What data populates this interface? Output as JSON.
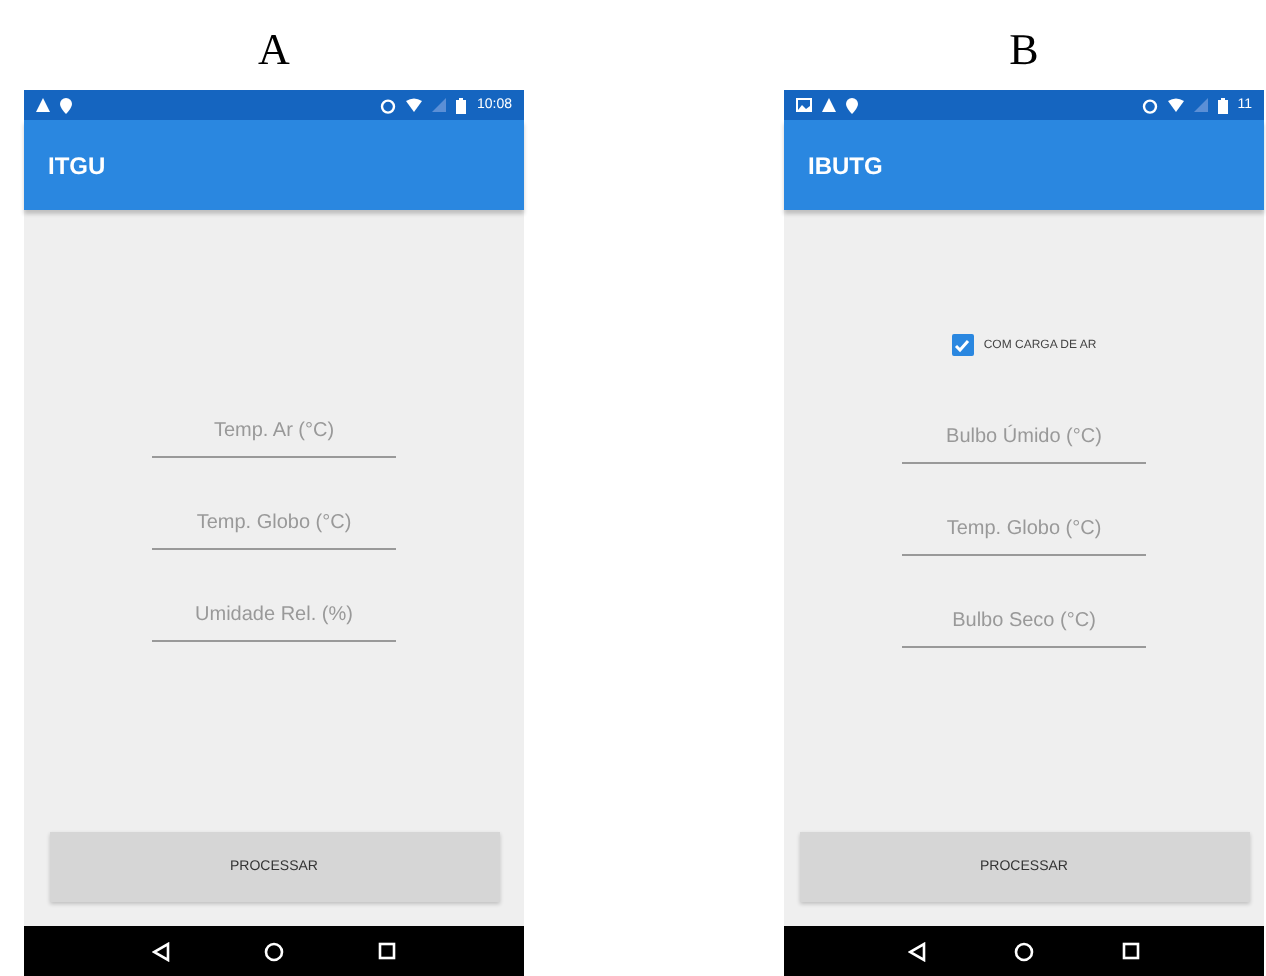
{
  "panels": [
    {
      "label": "A",
      "status": {
        "notifications": [
          {
            "kind": "warning"
          },
          {
            "kind": "pin"
          }
        ],
        "time": "10:08"
      },
      "app_title": "ITGU",
      "fields": [
        {
          "placeholder": "Temp. Ar (°C)"
        },
        {
          "placeholder": "Temp. Globo (°C)"
        },
        {
          "placeholder": "Umidade Rel. (%)"
        }
      ],
      "button": "PROCESSAR"
    },
    {
      "label": "B",
      "status": {
        "notifications": [
          {
            "kind": "image"
          },
          {
            "kind": "warning"
          },
          {
            "kind": "pin"
          }
        ],
        "time": "11"
      },
      "app_title": "IBUTG",
      "checkbox": {
        "label": "COM CARGA DE AR",
        "checked": true
      },
      "fields": [
        {
          "placeholder": "Bulbo Úmido (°C)"
        },
        {
          "placeholder": "Temp. Globo (°C)"
        },
        {
          "placeholder": "Bulbo Seco (°C)"
        }
      ],
      "button": "PROCESSAR"
    }
  ]
}
